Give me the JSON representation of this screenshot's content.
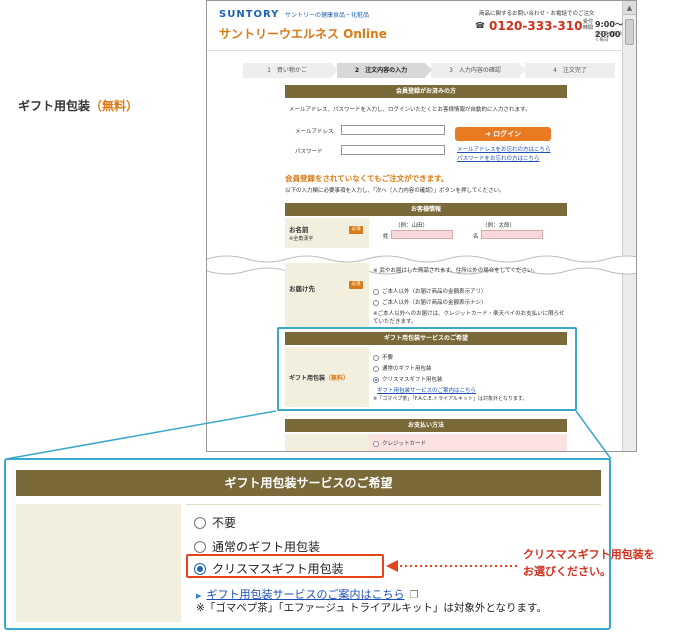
{
  "header": {
    "brand": "SUNTORY",
    "tagline": "サントリーの健康食品・化粧品",
    "site_name": "サントリーウエルネス Online",
    "phone_note": "商品に関するお問い合わせ・お電話でのご注文",
    "phone": "0120-333-310",
    "hours_label": "受付時間",
    "hours": "9:00～20:00",
    "hours_note": "年末年始を除く毎日"
  },
  "steps": [
    {
      "label": "1　買い物かご"
    },
    {
      "label": "2　注文内容の入力"
    },
    {
      "label": "3　入力内容の確認"
    },
    {
      "label": "4　注文完了"
    }
  ],
  "login": {
    "bar": "会員登録がお済みの方",
    "intro": "メールアドレス、パスワードを入力し、ログインいただくとお客様情報が自動的に入力されます。",
    "email_label": "メールアドレス",
    "password_label": "パスワード",
    "button": "ログイン",
    "forgot_email": "メールアドレスをお忘れの方はこちら",
    "forgot_password": "パスワードをお忘れの方はこちら"
  },
  "guest": {
    "heading": "会員登録をされていなくてもご注文ができます。",
    "note": "以下の入力欄に必要事項を入力し、「次へ（入力内容の確認）」ボタンを押してください。"
  },
  "customer": {
    "bar": "お客様情報",
    "name_label": "お名前",
    "name_sub": "※全角漢字",
    "required": "必須",
    "last_example": "（例：山田）",
    "first_example": "（例：太郎）",
    "last_label": "姓",
    "first_label": "名"
  },
  "delivery": {
    "label": "お届け先",
    "required": "必須",
    "cut_text": "※ 武やお届けした商品されます。住所以外の場合をしてください。",
    "opt_with_price": "ご本人以外（お届け商品の金額表示アリ）",
    "opt_no_price": "ご本人以外（お届け商品の金額表示ナシ）",
    "note": "※ご本人以外へのお届けは、クレジットカード・楽天ペイのお支払いに限らせていただきます。"
  },
  "gift_small": {
    "bar": "ギフト用包装サービスのご希望",
    "label": "ギフト用包装",
    "label_accent": "（無料）",
    "options": [
      "不要",
      "通常のギフト用包装",
      "クリスマスギフト用包装"
    ],
    "selected_index": 2,
    "link": "ギフト用包装サービスのご案内はこちら",
    "note": "※「ゴマペプ茶」「F.A.C.E.トライアルキット」は対象外となります。"
  },
  "payment": {
    "bar": "お支払い方法",
    "option": "クレジットカード"
  },
  "gift_zoom": {
    "bar": "ギフト用包装サービスのご希望",
    "label": "ギフト用包装",
    "label_accent": "（無料）",
    "opt1": "不要",
    "opt2": "通常のギフト用包装",
    "opt3": "クリスマスギフト用包装",
    "link": "ギフト用包装サービスのご案内はこちら",
    "note": "※「ゴマペプ茶」「エファージュ トライアルキット」は対象外となります。"
  },
  "callout": {
    "line1": "クリスマスギフト用包装を",
    "line2": "お選びください。"
  },
  "colors": {
    "bar": "#7a6a3a",
    "accent_orange": "#d97a14",
    "highlight_blue": "#3aa8c9",
    "select_red": "#e5451c",
    "link_blue": "#1e4fb5"
  }
}
